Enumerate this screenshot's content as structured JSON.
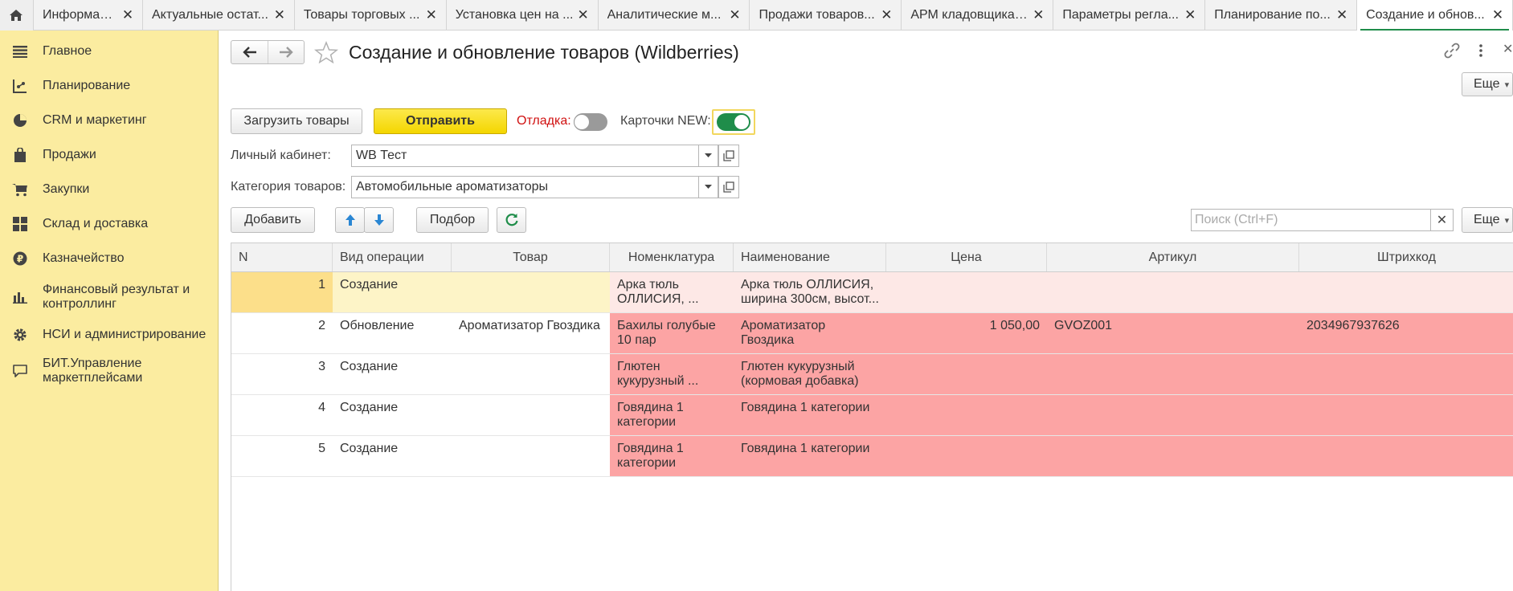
{
  "tabs": [
    {
      "label": "Информация"
    },
    {
      "label": "Актуальные остат..."
    },
    {
      "label": "Товары торговых ..."
    },
    {
      "label": "Установка цен на ..."
    },
    {
      "label": "Аналитические м..."
    },
    {
      "label": "Продажи товаров..."
    },
    {
      "label": "АРМ кладовщика ..."
    },
    {
      "label": "Параметры регла..."
    },
    {
      "label": "Планирование по..."
    },
    {
      "label": "Создание и обнов..."
    }
  ],
  "sidebar": {
    "items": [
      {
        "label": "Главное",
        "icon": "menu-lines-icon"
      },
      {
        "label": "Планирование",
        "icon": "planning-icon"
      },
      {
        "label": "CRM и маркетинг",
        "icon": "pie-chart-icon"
      },
      {
        "label": "Продажи",
        "icon": "shopping-bag-icon"
      },
      {
        "label": "Закупки",
        "icon": "cart-icon"
      },
      {
        "label": "Склад и доставка",
        "icon": "warehouse-grid-icon"
      },
      {
        "label": "Казначейство",
        "icon": "ruble-coin-icon"
      },
      {
        "label": "Финансовый результат и",
        "label2": "контроллинг",
        "icon": "bar-chart-icon"
      },
      {
        "label": "НСИ и администрирование",
        "icon": "gear-icon"
      },
      {
        "label": "БИТ.Управление",
        "label2": "маркетплейсами",
        "icon": "speech-bubble-icon"
      }
    ]
  },
  "header": {
    "title": "Создание и обновление товаров (Wildberries)",
    "more": "Еще"
  },
  "toolbar": {
    "load": "Загрузить товары",
    "send": "Отправить",
    "debug_label": "Отладка:",
    "debug_on": false,
    "cards_label": "Карточки NEW:",
    "cards_on": true
  },
  "form": {
    "cabinet_label": "Личный кабинет:",
    "cabinet_value": "WB Тест",
    "category_label": "Категория товаров:",
    "category_value": "Автомобильные ароматизаторы"
  },
  "table_toolbar": {
    "add": "Добавить",
    "pick": "Подбор",
    "search_placeholder": "Поиск (Ctrl+F)",
    "more": "Еще"
  },
  "table": {
    "columns": [
      "N",
      "Вид операции",
      "Товар",
      "Номенклатура",
      "Наименование",
      "Цена",
      "Артикул",
      "Штрихкод"
    ],
    "rows": [
      {
        "n": "1",
        "op": "Создание",
        "item": "",
        "nomen1": "Арка тюль",
        "nomen2": "ОЛЛИСИЯ, ...",
        "name1": "Арка тюль ОЛЛИСИЯ,",
        "name2": "ширина 300см, высот...",
        "price": "",
        "article": "",
        "barcode": ""
      },
      {
        "n": "2",
        "op": "Обновление",
        "item": "Ароматизатор Гвоздика",
        "nomen1": "Бахилы голубые",
        "nomen2": "10 пар",
        "name1": "Ароматизатор",
        "name2": "Гвоздика",
        "price": "1 050,00",
        "article": "GVOZ001",
        "barcode": "2034967937626"
      },
      {
        "n": "3",
        "op": "Создание",
        "item": "",
        "nomen1": "Глютен",
        "nomen2": "кукурузный ...",
        "name1": "Глютен кукурузный",
        "name2": "(кормовая добавка)",
        "price": "",
        "article": "",
        "barcode": ""
      },
      {
        "n": "4",
        "op": "Создание",
        "item": "",
        "nomen1": "Говядина 1",
        "nomen2": "категории",
        "name1": "Говядина 1 категории",
        "name2": "",
        "price": "",
        "article": "",
        "barcode": ""
      },
      {
        "n": "5",
        "op": "Создание",
        "item": "",
        "nomen1": "Говядина 1",
        "nomen2": "категории",
        "name1": "Говядина 1 категории",
        "name2": "",
        "price": "",
        "article": "",
        "barcode": ""
      }
    ]
  },
  "colors": {
    "sidebar": "#fbeca0",
    "accent": "#1f8d4a",
    "primary_button": "#f4d600",
    "error_row": "#fca4a4"
  }
}
